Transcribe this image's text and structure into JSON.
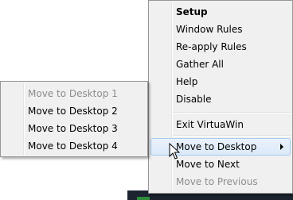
{
  "main_menu": {
    "items": [
      {
        "label": "Setup"
      },
      {
        "label": "Window Rules"
      },
      {
        "label": "Re-apply Rules"
      },
      {
        "label": "Gather All"
      },
      {
        "label": "Help"
      },
      {
        "label": "Disable"
      },
      {
        "label": "Exit VirtuaWin"
      },
      {
        "label": "Move to Desktop"
      },
      {
        "label": "Move to Next"
      },
      {
        "label": "Move to Previous"
      }
    ]
  },
  "sub_menu": {
    "items": [
      {
        "label": "Move to Desktop 1"
      },
      {
        "label": "Move to Desktop 2"
      },
      {
        "label": "Move to Desktop 3"
      },
      {
        "label": "Move to Desktop 4"
      }
    ]
  },
  "colors": {
    "menu_bg": "#f0f0f0",
    "highlight": "#dbe9f9",
    "disabled_text": "#8d8d8d"
  },
  "icons": {
    "submenu_arrow": "chevron-right-icon",
    "cursor": "mouse-pointer-icon",
    "tray": "virtuawin-tray-icon"
  }
}
